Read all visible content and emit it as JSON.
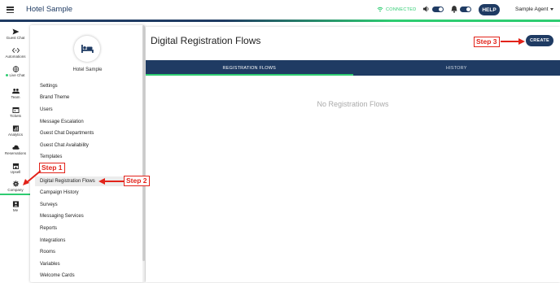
{
  "topbar": {
    "hotel_name": "Hotel Sample",
    "connection_status": "CONNECTED",
    "help_label": "HELP",
    "agent_name": "Sample Agent"
  },
  "rail": {
    "items": [
      {
        "label": "Guest Chat",
        "icon": "send-icon"
      },
      {
        "label": "Automations",
        "icon": "code-icon"
      },
      {
        "label": "Live Chat",
        "icon": "globe-icon"
      },
      {
        "label": "Team",
        "icon": "team-icon"
      },
      {
        "label": "Tickets",
        "icon": "calendar-icon"
      },
      {
        "label": "Analytics",
        "icon": "chart-icon"
      },
      {
        "label": "Reservations",
        "icon": "cloud-icon"
      },
      {
        "label": "Upsell",
        "icon": "store-icon"
      },
      {
        "label": "Company",
        "icon": "gear-icon"
      },
      {
        "label": "Me",
        "icon": "person-icon"
      }
    ]
  },
  "settings_panel": {
    "hotel_name": "Hotel Sample",
    "menu": [
      "Settings",
      "Brand Theme",
      "Users",
      "Message Escalation",
      "Guest Chat Departments",
      "Guest Chat Availability",
      "Templates",
      "Digital Registration Flows",
      "Campaign History",
      "Surveys",
      "Messaging Services",
      "Reports",
      "Integrations",
      "Rooms",
      "Variables",
      "Welcome Cards"
    ]
  },
  "main": {
    "title": "Digital Registration Flows",
    "create_label": "CREATE",
    "tabs": [
      "REGISTRATION FLOWS",
      "HISTORY"
    ],
    "empty_message": "No Registration Flows"
  },
  "annotations": {
    "step1": "Step 1",
    "step2": "Step 2",
    "step3": "Step 3"
  },
  "colors": {
    "brand_navy": "#1f3b63",
    "accent_green": "#2ecc71",
    "annotation_red": "#e2231a"
  }
}
